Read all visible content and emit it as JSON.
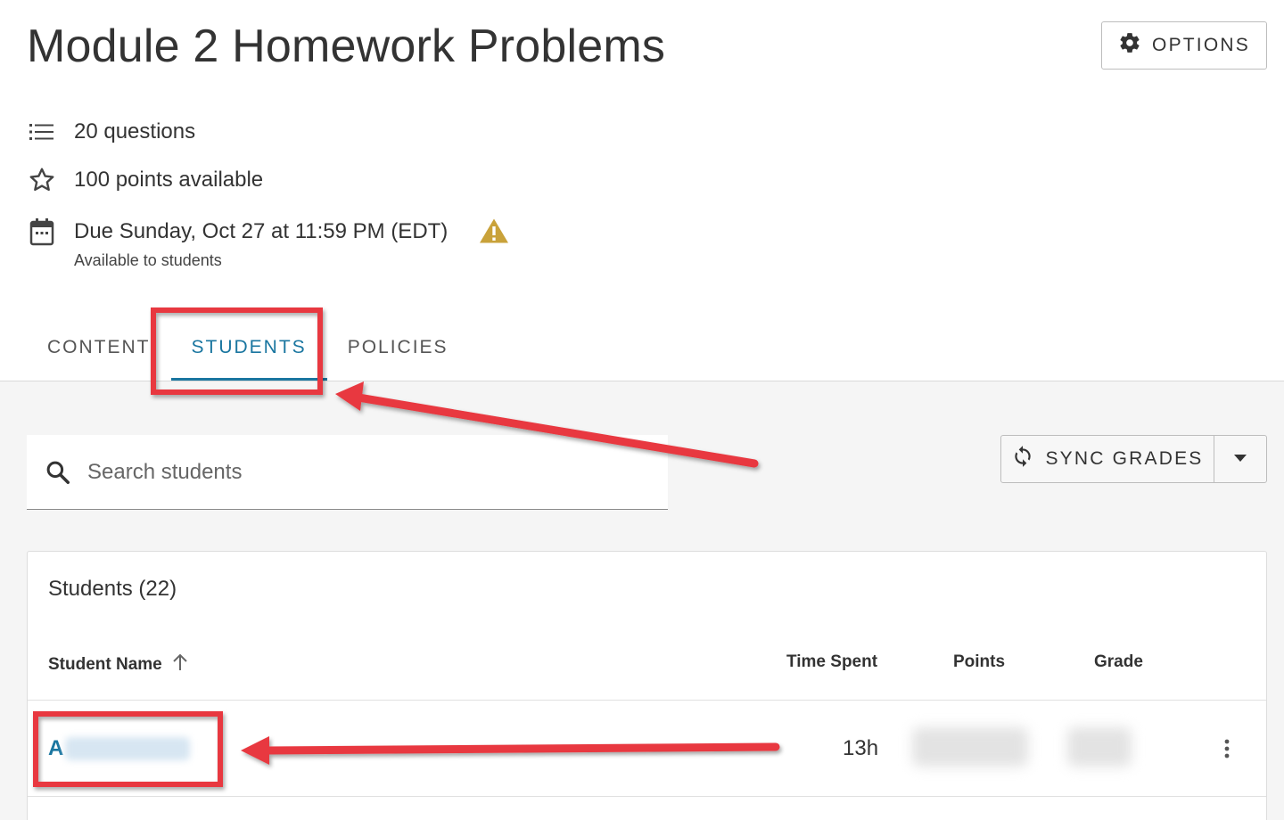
{
  "header": {
    "title": "Module 2 Homework Problems",
    "options_label": "OPTIONS",
    "options_icon": "gear-icon"
  },
  "meta": {
    "questions": "20 questions",
    "points": "100 points available",
    "due": "Due Sunday, Oct 27 at 11:59 PM (EDT)",
    "availability": "Available to students",
    "icons": [
      "list-icon",
      "star-icon",
      "calendar-icon",
      "warning-icon"
    ]
  },
  "tabs": [
    {
      "label": "CONTENT",
      "active": false
    },
    {
      "label": "STUDENTS",
      "active": true
    },
    {
      "label": "POLICIES",
      "active": false
    }
  ],
  "search": {
    "placeholder": "Search students"
  },
  "sync": {
    "label": "SYNC GRADES",
    "icon": "sync-icon"
  },
  "students_panel": {
    "title": "Students (22)",
    "columns": [
      "Student Name",
      "Time Spent",
      "Points",
      "Grade"
    ],
    "rows": [
      {
        "name_visible": "A",
        "time_spent": "13h"
      }
    ]
  },
  "colors": {
    "accent": "#1a76a0",
    "annotation": "#e8393f",
    "warning": "#c9a23a"
  }
}
